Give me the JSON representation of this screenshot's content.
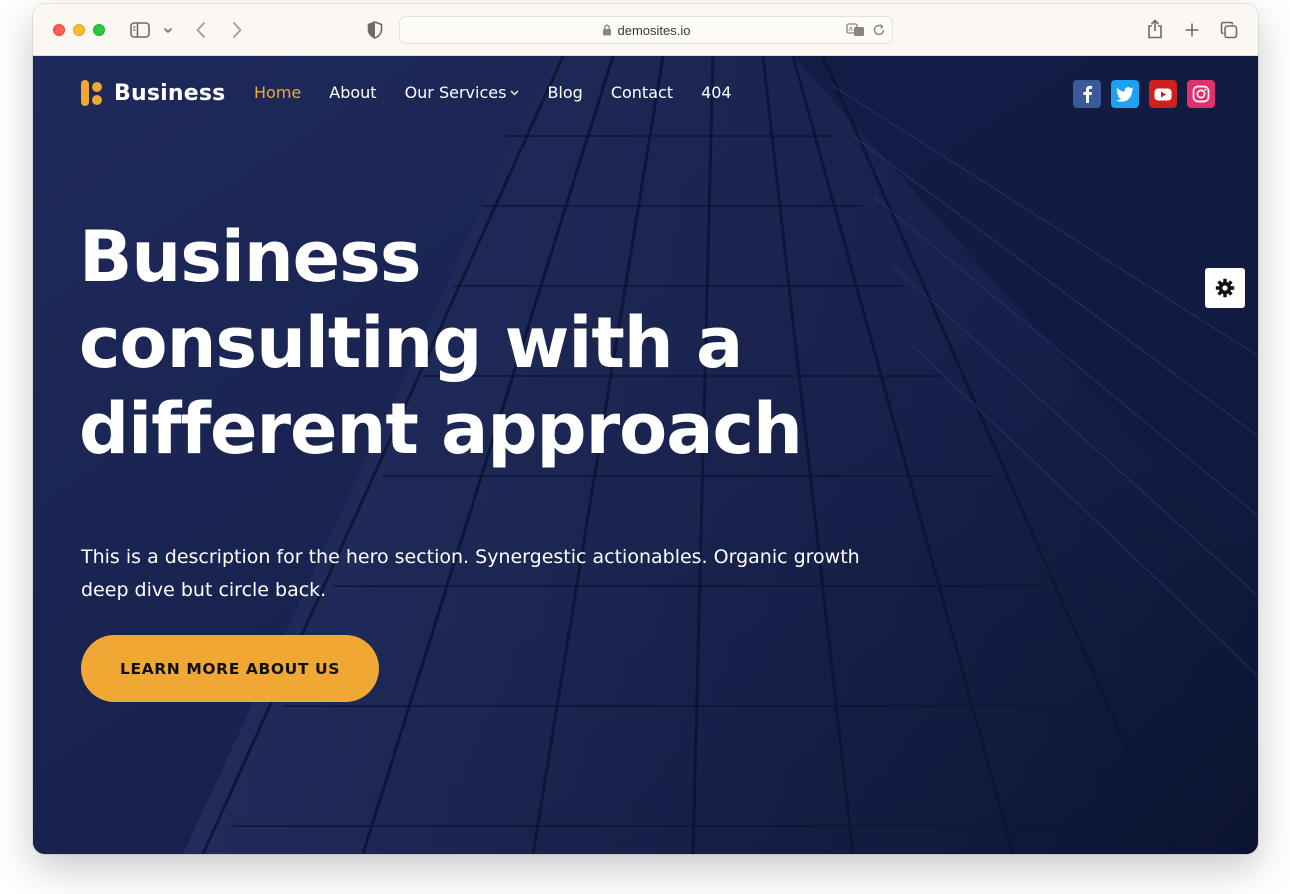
{
  "browser": {
    "url": "demosites.io",
    "icons": [
      "sidebar-icon",
      "chevron-down-icon",
      "back-icon",
      "forward-icon",
      "shield-icon",
      "lock-icon",
      "translate-icon",
      "reload-icon",
      "share-icon",
      "new-tab-icon",
      "tabs-overview-icon"
    ]
  },
  "header": {
    "logo_text": "Business",
    "nav": [
      {
        "label": "Home",
        "active": true
      },
      {
        "label": "About"
      },
      {
        "label": "Our Services",
        "has_dropdown": true
      },
      {
        "label": "Blog"
      },
      {
        "label": "Contact"
      },
      {
        "label": "404"
      }
    ],
    "socials": [
      {
        "name": "facebook-icon",
        "color": "#3b5998"
      },
      {
        "name": "twitter-icon",
        "color": "#1da1f2"
      },
      {
        "name": "youtube-icon",
        "color": "#cd201f"
      },
      {
        "name": "instagram-icon",
        "color": "#e1306c"
      }
    ]
  },
  "hero": {
    "title": "Business consulting with a different approach",
    "description": "This is a description for the hero section. Synergestic actionables. Organic growth deep dive but circle back.",
    "cta_label": "LEARN MORE ABOUT US"
  },
  "colors": {
    "accent": "#f0a733",
    "hero_overlay": "#1b2656",
    "text": "#ffffff"
  }
}
